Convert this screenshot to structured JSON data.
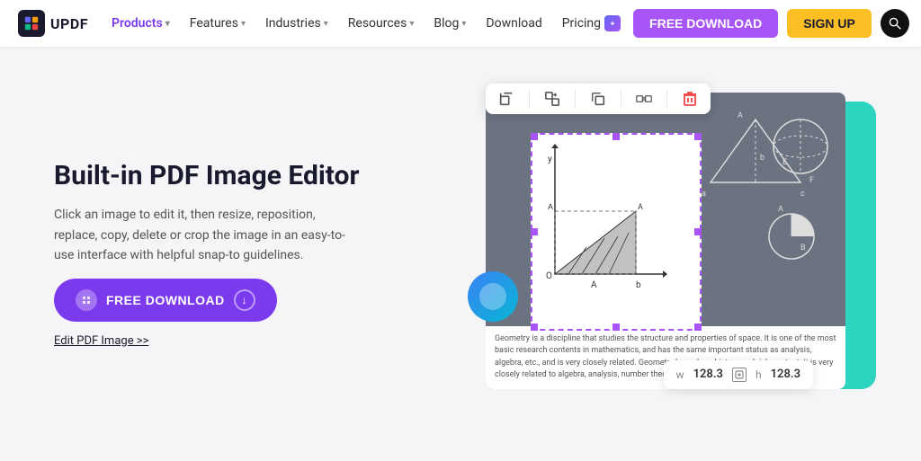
{
  "nav": {
    "logo_text": "UPDF",
    "items": [
      {
        "label": "Products",
        "active": true,
        "has_chevron": true
      },
      {
        "label": "Features",
        "active": false,
        "has_chevron": true
      },
      {
        "label": "Industries",
        "active": false,
        "has_chevron": true
      },
      {
        "label": "Resources",
        "active": false,
        "has_chevron": true
      },
      {
        "label": "Blog",
        "active": false,
        "has_chevron": true
      },
      {
        "label": "Download",
        "active": false,
        "has_chevron": false
      },
      {
        "label": "Pricing",
        "active": false,
        "has_chevron": false
      }
    ],
    "btn_free_download": "FREE DOWNLOAD",
    "btn_sign_up": "SIGN UP"
  },
  "hero": {
    "title": "Built-in PDF Image Editor",
    "description": "Click an image to edit it, then resize, reposition, replace, copy, delete or crop the image in an easy-to-use interface with helpful snap-to guidelines.",
    "btn_download": "FREE DOWNLOAD",
    "edit_link": "Edit PDF Image >>"
  },
  "pdf_mockup": {
    "toolbar_icons": [
      "crop",
      "replace",
      "copy",
      "delete"
    ],
    "dimensions": {
      "w_label": "w",
      "w_value": "128.3",
      "h_label": "h",
      "h_value": "128.3"
    },
    "text_content": "Geometry is a discipline that studies the structure and properties of space. It is one of the most basic research contents in mathematics, and has the same important status as analysis, algebra, etc., and is very closely related. Geometry has a long history and rich content. It is very closely related to algebra, analysis, number theory, etc."
  }
}
